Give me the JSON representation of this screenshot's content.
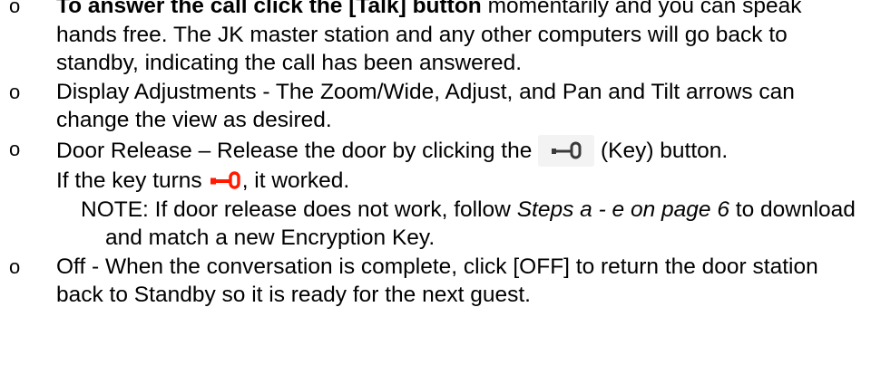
{
  "bullet_glyph": "o",
  "items": [
    {
      "lead_bold": "To answer the call click the [Talk] button",
      "text": " momentarily and you can speak hands free.  The JK master station and any other computers will go back to standby, indicating the call has been answered."
    },
    {
      "text": "Display Adjustments - The Zoom/Wide, Adjust, and Pan and Tilt arrows can change the view as desired."
    },
    {
      "text_before_icon": "Door Release – Release the door by clicking the",
      "text_after_icon": "(Key) button.",
      "line2_before_icon": "If the key turns",
      "line2_after_icon": ", it worked.",
      "note_prefix": "NOTE: If door release does not work, follow ",
      "note_italic": "Steps a - e on page 6",
      "note_suffix": " to download and match a new Encryption Key."
    },
    {
      "text": "Off - When the conversation is complete, click [OFF] to return the door station back to Standby so it is ready for the next guest."
    }
  ],
  "icons": {
    "key_button": "key-icon",
    "key_active": "key-icon-red"
  },
  "colors": {
    "key_default": "#3a3a3a",
    "key_active": "#ff1a00"
  }
}
